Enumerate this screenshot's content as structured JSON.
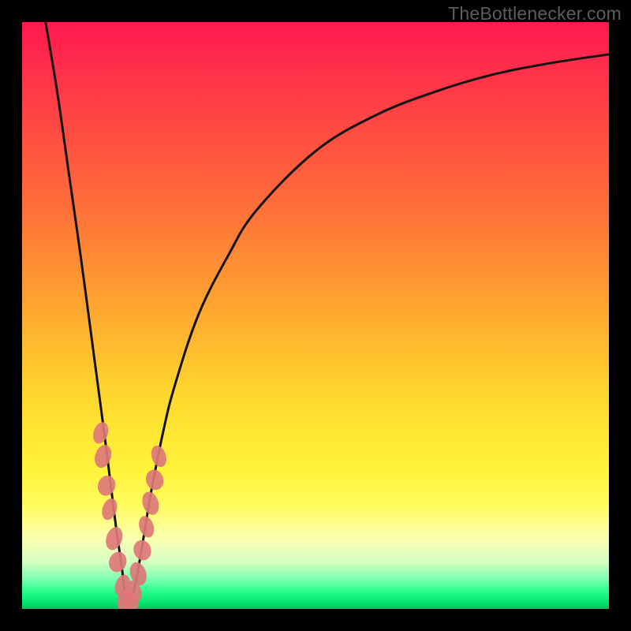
{
  "watermark": "TheBottlenecker.com",
  "colors": {
    "frame": "#000000",
    "gradient_top": "#ff1950",
    "gradient_mid": "#ffd22e",
    "gradient_bottom": "#00c25c",
    "curve_stroke": "#141210",
    "marker_fill": "#dd7878",
    "marker_stroke": "#a94a4a"
  },
  "chart_data": {
    "type": "line",
    "title": "",
    "xlabel": "",
    "ylabel": "",
    "xlim": [
      0,
      100
    ],
    "ylim": [
      0,
      100
    ],
    "series": [
      {
        "name": "bottleneck-curve",
        "x": [
          4,
          6,
          8,
          10,
          12,
          14,
          15,
          16,
          17,
          17.5,
          18,
          19,
          20,
          21,
          22,
          24,
          26,
          30,
          35,
          40,
          50,
          60,
          70,
          80,
          90,
          100
        ],
        "y": [
          100,
          88,
          74,
          60,
          45,
          30,
          22,
          14,
          7,
          3,
          1,
          3,
          8,
          14,
          20,
          30,
          38,
          50,
          60,
          68,
          78,
          84,
          88,
          91,
          93,
          94.5
        ]
      }
    ],
    "markers": {
      "name": "highlight-points",
      "x": [
        13.4,
        13.8,
        14.4,
        14.9,
        15.7,
        16.3,
        17.1,
        17.6,
        18.4,
        19.1,
        19.8,
        20.5,
        21.2,
        21.9,
        22.6,
        23.3
      ],
      "y": [
        30,
        26,
        21,
        17,
        12,
        8,
        4,
        1.5,
        1.2,
        3,
        6,
        10,
        14,
        18,
        22,
        26
      ]
    }
  }
}
